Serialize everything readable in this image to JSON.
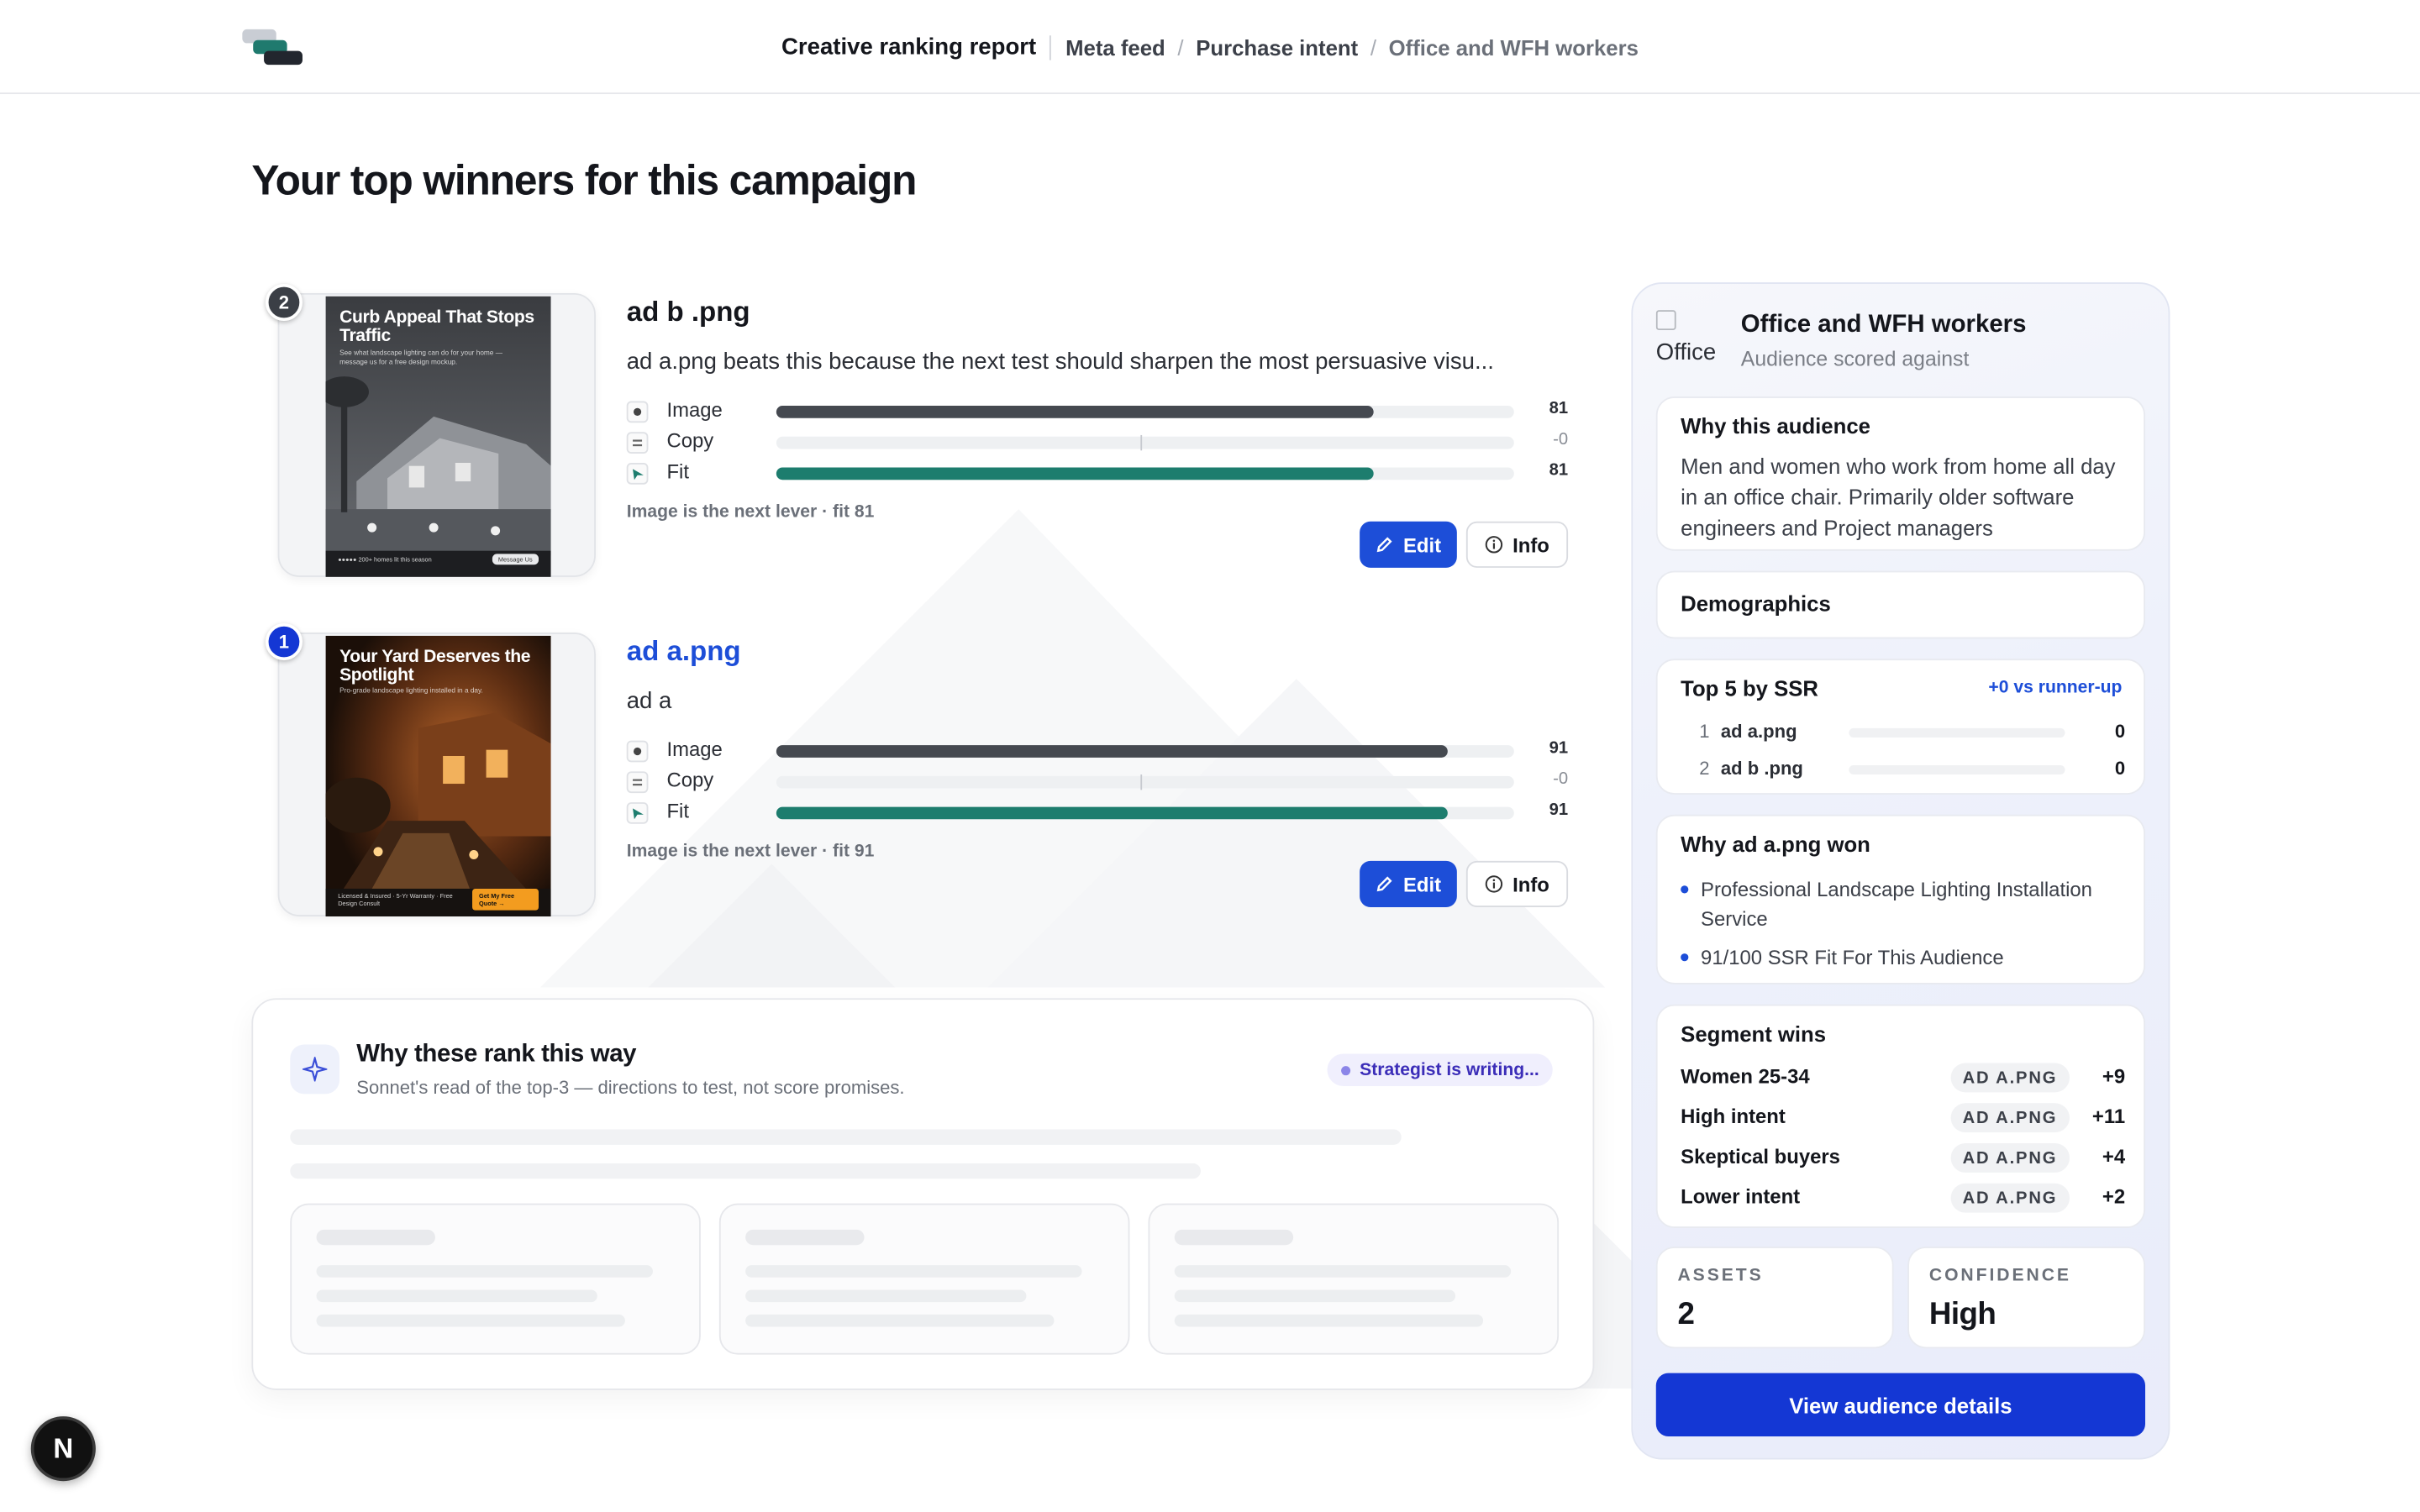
{
  "header": {
    "report_title": "Creative ranking report",
    "crumbs": [
      "Meta feed",
      "Purchase intent"
    ],
    "current": "Office and WFH workers"
  },
  "page_title": "Your top winners for this campaign",
  "ads": [
    {
      "rank": "2",
      "name": "ad b .png",
      "description": "ad a.png beats this because the next test should sharpen the most persuasive visu...",
      "thumb_headline": "Curb Appeal That Stops Traffic",
      "thumb_sub": "See what landscape lighting can do for your home — message us for a free design mockup.",
      "thumb_left": "●●●●● 200+ homes lit this season",
      "thumb_right": "Message Us",
      "metrics": [
        {
          "label": "Image",
          "value": "81",
          "fill": 0.81
        },
        {
          "label": "Copy",
          "value": "-0",
          "fill": 0
        },
        {
          "label": "Fit",
          "value": "81",
          "fill": 0.81
        }
      ],
      "lever": "Image is the next lever · fit 81",
      "edit_label": "Edit",
      "info_label": "Info"
    },
    {
      "rank": "1",
      "name": "ad a.png",
      "description": "ad a",
      "thumb_headline": "Your Yard Deserves the Spotlight",
      "thumb_sub": "Pro-grade landscape lighting installed in a day.",
      "thumb_left": "Licensed & Insured · 5-Yr Warranty · Free Design Consult",
      "thumb_right": "Get My Free Quote →",
      "metrics": [
        {
          "label": "Image",
          "value": "91",
          "fill": 0.91
        },
        {
          "label": "Copy",
          "value": "-0",
          "fill": 0
        },
        {
          "label": "Fit",
          "value": "91",
          "fill": 0.91
        }
      ],
      "lever": "Image is the next lever · fit 91",
      "edit_label": "Edit",
      "info_label": "Info"
    }
  ],
  "why": {
    "title": "Why these rank this way",
    "subtitle": "Sonnet's read of the top-3 — directions to test, not score promises.",
    "status": "Strategist is writing..."
  },
  "panel": {
    "image_alt": "Office",
    "audience_name": "Office and WFH workers",
    "audience_sub": "Audience scored against",
    "why_audience_title": "Why this audience",
    "why_audience_text": "Men and women who work from home all day in an office chair. Primarily older software engineers and Project managers",
    "demographics_title": "Demographics",
    "top5_title": "Top 5 by SSR",
    "top5_delta": "+0 vs runner-up",
    "top5": [
      {
        "rank": "1",
        "name": "ad a.png",
        "value": "0"
      },
      {
        "rank": "2",
        "name": "ad b .png",
        "value": "0"
      }
    ],
    "won_title": "Why ad a.png won",
    "won_bullets": [
      "Professional Landscape Lighting Installation Service",
      "91/100 SSR Fit For This Audience"
    ],
    "segment_title": "Segment wins",
    "segments": [
      {
        "label": "Women 25-34",
        "winner": "AD A.PNG",
        "value": "+9"
      },
      {
        "label": "High intent",
        "winner": "AD A.PNG",
        "value": "+11"
      },
      {
        "label": "Skeptical buyers",
        "winner": "AD A.PNG",
        "value": "+4"
      },
      {
        "label": "Lower intent",
        "winner": "AD A.PNG",
        "value": "+2"
      }
    ],
    "assets_label": "ASSETS",
    "assets_value": "2",
    "confidence_label": "CONFIDENCE",
    "confidence_value": "High",
    "view_button": "View audience details"
  },
  "dev_badge": "N",
  "colors": {
    "accent": "#1d4ed8",
    "primary_button": "#1437d4",
    "image_bar": "#454950",
    "fit_bar": "#1d7d6e"
  }
}
